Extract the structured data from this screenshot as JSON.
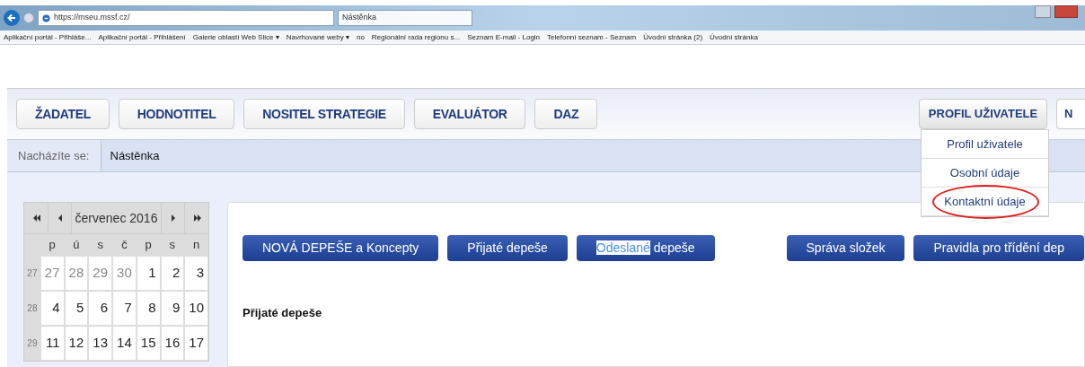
{
  "browser": {
    "address": "https://mseu.mssf.cz/",
    "tab": "Nástěnka",
    "favorites": [
      {
        "label": "Aplikační portál - Přihláše..."
      },
      {
        "label": "Aplikační portál - Přihlášení"
      },
      {
        "label": "Galerie oblastí Web Slice ▾"
      },
      {
        "label": "Navrhované weby ▾"
      },
      {
        "label": "no"
      },
      {
        "label": "Regionální rada regionu s..."
      },
      {
        "label": "Seznam E-mail - Login"
      },
      {
        "label": "Telefonní seznam - Seznam"
      },
      {
        "label": "Úvodní stránka (2)"
      },
      {
        "label": "Úvodní stránka"
      }
    ]
  },
  "nav": {
    "roles": [
      "ŽADATEL",
      "HODNOTITEL",
      "NOSITEL STRATEGIE",
      "EVALUÁTOR",
      "DAZ"
    ],
    "profile": {
      "label": "PROFIL UŽIVATELE",
      "expanded": true,
      "items": [
        {
          "label": "Profil uživatele",
          "circled": false
        },
        {
          "label": "Osobní údaje",
          "circled": false
        },
        {
          "label": "Kontaktní údaje",
          "circled": true
        }
      ]
    },
    "cut_button": "N"
  },
  "breadcrumb": {
    "prefix": "Nacházíte se:",
    "current": "Nástěnka"
  },
  "calendar": {
    "month": "červenec 2016",
    "weekdays": [
      "p",
      "ú",
      "s",
      "č",
      "p",
      "s",
      "n"
    ],
    "weeks": [
      {
        "number": "27",
        "days": [
          {
            "day": "27",
            "muted": true
          },
          {
            "day": "28",
            "muted": true
          },
          {
            "day": "29",
            "muted": true
          },
          {
            "day": "30",
            "muted": true
          },
          {
            "day": "1",
            "muted": false
          },
          {
            "day": "2",
            "muted": false
          },
          {
            "day": "3",
            "muted": false
          }
        ]
      },
      {
        "number": "28",
        "days": [
          {
            "day": "4",
            "muted": false
          },
          {
            "day": "5",
            "muted": false
          },
          {
            "day": "6",
            "muted": false
          },
          {
            "day": "7",
            "muted": false
          },
          {
            "day": "8",
            "muted": false
          },
          {
            "day": "9",
            "muted": false
          },
          {
            "day": "10",
            "muted": false
          }
        ]
      },
      {
        "number": "29",
        "days": [
          {
            "day": "11",
            "muted": false
          },
          {
            "day": "12",
            "muted": false
          },
          {
            "day": "13",
            "muted": false
          },
          {
            "day": "14",
            "muted": false
          },
          {
            "day": "15",
            "muted": false
          },
          {
            "day": "16",
            "muted": false
          },
          {
            "day": "17",
            "muted": false
          }
        ]
      }
    ]
  },
  "messages": {
    "left_buttons": [
      {
        "parts": [
          {
            "text": "NOVÁ DEPEŠE a Koncepty",
            "highlighted": false
          }
        ]
      },
      {
        "parts": [
          {
            "text": "Přijaté depeše",
            "highlighted": false
          }
        ]
      },
      {
        "parts": [
          {
            "text": "Odeslané",
            "highlighted": true
          },
          {
            "text": "depeše",
            "highlighted": false
          }
        ]
      }
    ],
    "right_buttons": [
      "Správa složek",
      "Pravidla pro třídění dep"
    ],
    "section_title": "Přijaté depeše"
  }
}
